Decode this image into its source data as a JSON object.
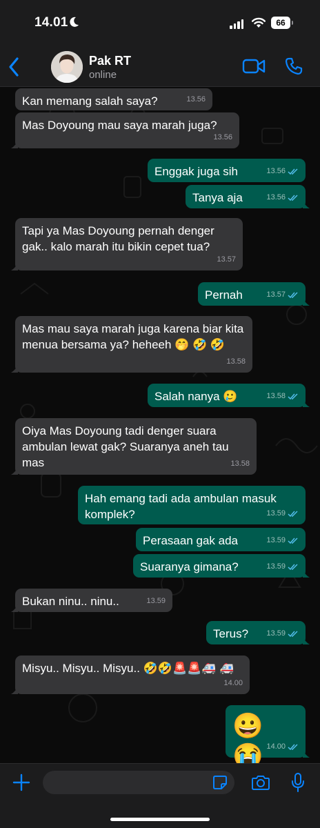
{
  "status_bar": {
    "time": "14.01",
    "battery": "66"
  },
  "header": {
    "name": "Pak RT",
    "status": "online"
  },
  "messages": [
    {
      "dir": "in",
      "text": "Kan memang salah saya?",
      "time": "13.56"
    },
    {
      "dir": "in",
      "text": "Mas Doyoung mau saya marah juga?",
      "time": "13.56"
    },
    {
      "dir": "out",
      "text": "Enggak juga sih",
      "time": "13.56"
    },
    {
      "dir": "out",
      "text": "Tanya aja",
      "time": "13.56"
    },
    {
      "dir": "in",
      "text": "Tapi ya Mas Doyoung pernah denger gak.. kalo marah itu bikin cepet tua?",
      "time": "13.57"
    },
    {
      "dir": "out",
      "text": "Pernah",
      "time": "13.57"
    },
    {
      "dir": "in",
      "text": "Mas mau saya marah juga karena biar kita menua bersama ya? heheeh 🤭 🤣 🤣",
      "time": "13.58"
    },
    {
      "dir": "out",
      "text": "Salah nanya 🥲",
      "time": "13.58"
    },
    {
      "dir": "in",
      "text": "Oiya Mas Doyoung tadi denger suara ambulan lewat gak? Suaranya aneh tau mas",
      "time": "13.58"
    },
    {
      "dir": "out",
      "text": "Hah emang tadi ada ambulan masuk komplek?",
      "time": "13.59"
    },
    {
      "dir": "out",
      "text": "Perasaan gak ada",
      "time": "13.59"
    },
    {
      "dir": "out",
      "text": "Suaranya gimana?",
      "time": "13.59"
    },
    {
      "dir": "in",
      "text": "Bukan ninu.. ninu..",
      "time": "13.59"
    },
    {
      "dir": "out",
      "text": "Terus?",
      "time": "13.59"
    },
    {
      "dir": "in",
      "text": "Misyu.. Misyu.. Misyu.. 🤣🤣🚨🚨🚑 🚑",
      "time": "14.00"
    },
    {
      "dir": "out",
      "text": "😀 😭",
      "time": "14.00"
    }
  ],
  "input": {
    "placeholder": ""
  },
  "icons": {
    "back": "chevron-left-icon",
    "video": "video-camera-icon",
    "call": "phone-icon",
    "plus": "plus-icon",
    "sticker": "sticker-icon",
    "camera": "camera-icon",
    "mic": "microphone-icon",
    "read": "double-check-icon",
    "status_moon": "moon-icon",
    "status_signal": "signal-icon",
    "status_wifi": "wifi-icon"
  },
  "colors": {
    "incoming_bubble": "#363638",
    "outgoing_bubble": "#005b4e",
    "accent_blue": "#0a84ff",
    "read_tick": "#53bdeb",
    "bar_background": "#1c1c1d"
  }
}
